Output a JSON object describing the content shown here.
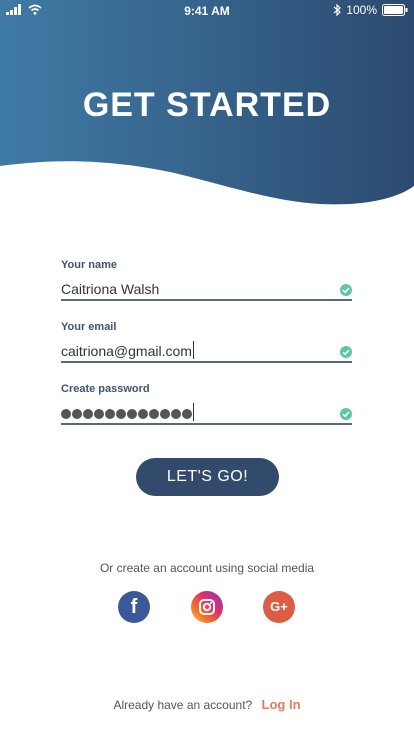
{
  "statusbar": {
    "time": "9:41 AM",
    "battery": "100%"
  },
  "header": {
    "title": "GET STARTED"
  },
  "form": {
    "name_label": "Your name",
    "name_value": "Caitriona Walsh",
    "email_label": "Your email",
    "email_value": "caitriona@gmail.com",
    "password_label": "Create password",
    "password_mask_count": 12
  },
  "cta": {
    "label": "LET'S GO!"
  },
  "social": {
    "prompt": "Or create an account using social media",
    "facebook_glyph": "f",
    "google_glyph": "G+"
  },
  "footer": {
    "question": "Already have an account?",
    "login_label": "Log In"
  },
  "colors": {
    "header_gradient_start": "#3f7ba5",
    "header_gradient_end": "#2c4a70",
    "accent": "#324b6c",
    "valid": "#5cc7a6",
    "link": "#e67a5c"
  }
}
